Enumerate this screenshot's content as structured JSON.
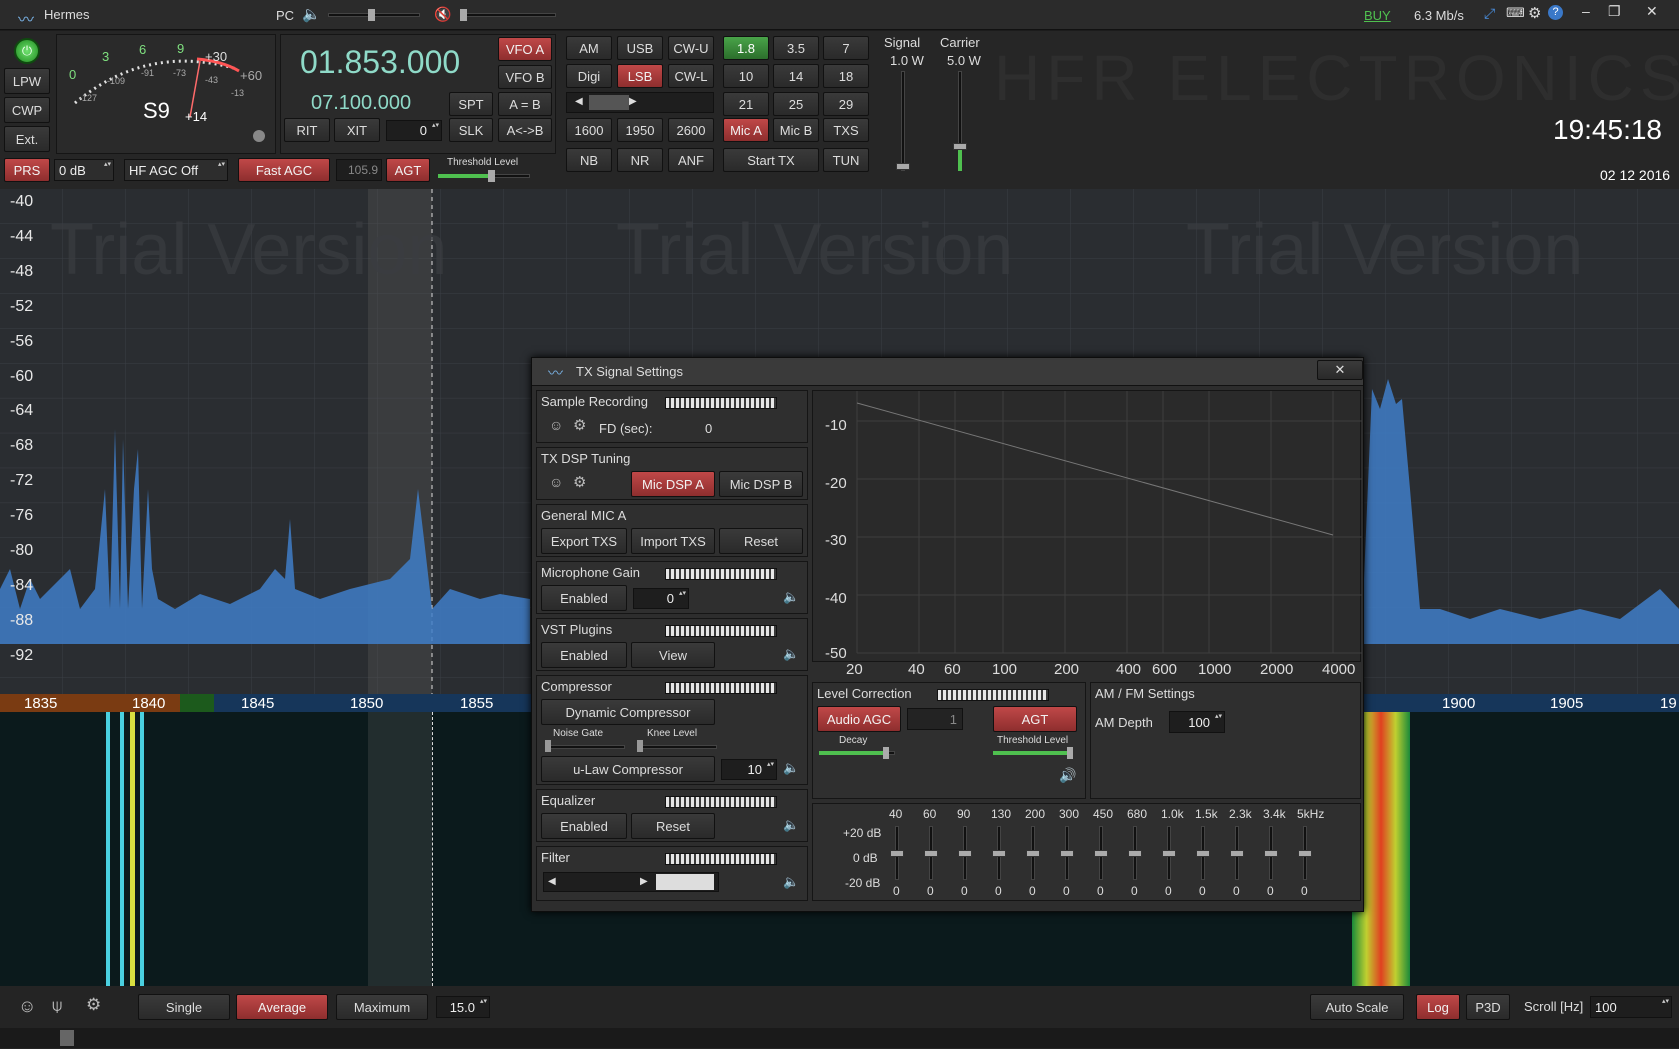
{
  "titlebar": {
    "app_title": "Hermes",
    "pc_label": "PC",
    "buy": "BUY",
    "rate": "6.3 Mb/s"
  },
  "smeter": {
    "scale_top": [
      "3",
      "6",
      "9",
      "+30",
      "+60"
    ],
    "scale_zero": "0",
    "scale_mid": [
      "-109",
      "-91",
      "-73",
      "-43",
      "-13"
    ],
    "scale_low": "-127",
    "reading": "S9",
    "reading_over": "+14"
  },
  "left_buttons": [
    "LPW",
    "CWP",
    "Ext."
  ],
  "vfo": {
    "freq_a": "01.853.000",
    "freq_b": "07.100.000",
    "vfo_a": "VFO A",
    "vfo_b": "VFO B",
    "spt": "SPT",
    "a_eq_b": "A = B",
    "rit": "RIT",
    "xit": "XIT",
    "offset_value": "0",
    "slk": "SLK",
    "a_swap_b": "A<->B"
  },
  "modes": [
    "AM",
    "USB",
    "CW-U",
    "Digi",
    "LSB",
    "CW-L"
  ],
  "filters": [
    "1600",
    "1950",
    "2600"
  ],
  "dsp": [
    "NB",
    "NR",
    "ANF"
  ],
  "bands": [
    "1.8",
    "3.5",
    "7",
    "10",
    "14",
    "18",
    "21",
    "25",
    "29"
  ],
  "mic": {
    "mic_a": "Mic A",
    "mic_b": "Mic B",
    "txs": "TXS"
  },
  "tx": {
    "start_tx": "Start TX",
    "tun": "TUN"
  },
  "agc_row": {
    "prs": "PRS",
    "gain": "0 dB",
    "agc_mode": "HF AGC Off",
    "fast_agc": "Fast AGC",
    "agc_value": "105.9",
    "agt": "AGT",
    "threshold": "Threshold Level"
  },
  "power": {
    "signal_label": "Signal",
    "signal_value": "1.0 W",
    "carrier_label": "Carrier",
    "carrier_value": "5.0 W",
    "signal_level": 0.05,
    "carrier_level": 0.28
  },
  "brand_watermark": "HFR ELECTRONICS",
  "clock": {
    "time": "19:45:18",
    "date": "02 12 2016"
  },
  "spectrum": {
    "watermark": "Trial Version",
    "db_labels": [
      "-40",
      "-44",
      "-48",
      "-52",
      "-56",
      "-60",
      "-64",
      "-68",
      "-72",
      "-76",
      "-80",
      "-84",
      "-88",
      "-92"
    ],
    "freq_labels": [
      "1835",
      "1840",
      "1845",
      "1850",
      "1855",
      "1900",
      "1905",
      "19"
    ]
  },
  "dialog": {
    "title": "TX Signal Settings",
    "close": "✕",
    "sample_recording": "Sample Recording",
    "fd_label": "FD (sec):",
    "fd_value": "0",
    "tx_dsp_tuning": "TX DSP Tuning",
    "mic_dsp_a": "Mic DSP A",
    "mic_dsp_b": "Mic DSP B",
    "general_mic": "General MIC A",
    "export_txs": "Export TXS",
    "import_txs": "Import TXS",
    "reset": "Reset",
    "mic_gain": "Microphone Gain",
    "enabled": "Enabled",
    "mic_gain_value": "0",
    "vst_plugins": "VST Plugins",
    "view": "View",
    "compressor": "Compressor",
    "dynamic_compressor": "Dynamic Compressor",
    "noise_gate": "Noise Gate",
    "knee_level": "Knee Level",
    "ulaw": "u-Law Compressor",
    "ulaw_value": "10",
    "equalizer": "Equalizer",
    "filter": "Filter",
    "graph_y": [
      "-10",
      "-20",
      "-30",
      "-40",
      "-50"
    ],
    "graph_x": [
      "20",
      "40",
      "60",
      "100",
      "200",
      "400",
      "600",
      "1000",
      "2000",
      "4000"
    ],
    "level_correction": "Level Correction",
    "audio_agc": "Audio AGC",
    "audio_agc_value": "1",
    "agt": "AGT",
    "decay": "Decay",
    "threshold_level": "Threshold Level",
    "am_fm_settings": "AM / FM Settings",
    "am_depth": "AM Depth",
    "am_depth_value": "100",
    "eq_bands": [
      "40",
      "60",
      "90",
      "130",
      "200",
      "300",
      "450",
      "680",
      "1.0k",
      "1.5k",
      "2.3k",
      "3.4k",
      "5kHz"
    ],
    "eq_values": [
      "0",
      "0",
      "0",
      "0",
      "0",
      "0",
      "0",
      "0",
      "0",
      "0",
      "0",
      "0",
      "0"
    ],
    "eq_db": [
      "+20 dB",
      "0 dB",
      "-20 dB"
    ]
  },
  "bottom": {
    "single": "Single",
    "average": "Average",
    "maximum": "Maximum",
    "avg_value": "15.0",
    "auto_scale": "Auto Scale",
    "log": "Log",
    "p3d": "P3D",
    "scroll_label": "Scroll [Hz]",
    "scroll_value": "100"
  }
}
